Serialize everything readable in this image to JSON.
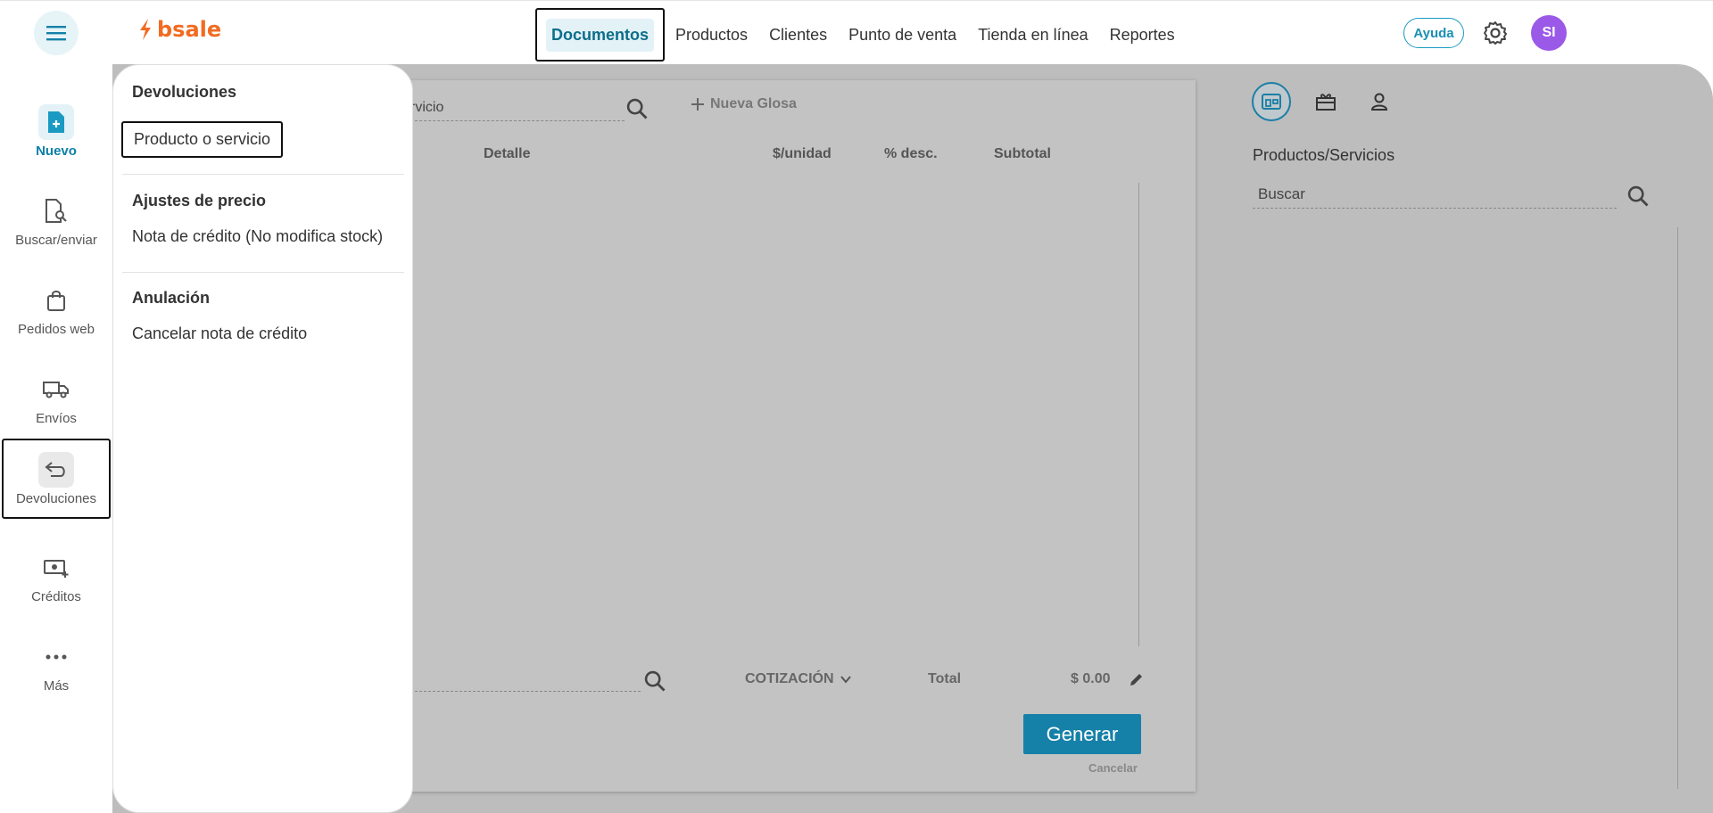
{
  "brand": {
    "name": "bsale"
  },
  "topnav": {
    "items": [
      "Documentos",
      "Productos",
      "Clientes",
      "Punto de venta",
      "Tienda en línea",
      "Reportes"
    ],
    "help": "Ayuda",
    "avatar_initials": "SI"
  },
  "sidebar": {
    "items": [
      {
        "label": "Nuevo"
      },
      {
        "label": "Buscar/enviar"
      },
      {
        "label": "Pedidos web"
      },
      {
        "label": "Envíos"
      },
      {
        "label": "Devoluciones"
      },
      {
        "label": "Créditos"
      },
      {
        "label": "Más"
      }
    ]
  },
  "dropdown": {
    "sections": [
      {
        "title": "Devoluciones",
        "items": [
          "Producto o servicio"
        ]
      },
      {
        "title": "Ajustes de precio",
        "items": [
          "Nota de crédito (No modifica stock)"
        ]
      },
      {
        "title": "Anulación",
        "items": [
          "Cancelar nota de crédito"
        ]
      }
    ]
  },
  "document": {
    "search_value": "rvicio",
    "new_glosa": "Nueva Glosa",
    "columns": [
      "Detalle",
      "$/unidad",
      "% desc.",
      "Subtotal"
    ],
    "doc_type": "COTIZACIÓN",
    "total_label": "Total",
    "total_value": "$ 0.00",
    "generate": "Generar",
    "cancel": "Cancelar"
  },
  "right_panel": {
    "title": "Productos/Servicios",
    "search_placeholder": "Buscar"
  },
  "colors": {
    "accent": "#1681a8",
    "brand": "#f26b21",
    "avatar": "#9b59e8"
  }
}
